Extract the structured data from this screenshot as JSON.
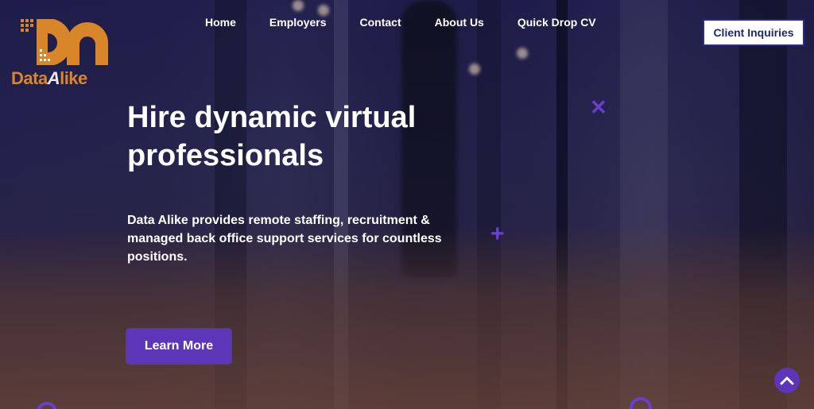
{
  "brand": {
    "name_part1": "Data",
    "name_part2": "A",
    "name_part3": "like",
    "primary_color": "#d9862b",
    "accent_color": "#5d35b8"
  },
  "nav": {
    "items": [
      {
        "label": "Home"
      },
      {
        "label": "Employers"
      },
      {
        "label": "Contact"
      },
      {
        "label": "About Us"
      },
      {
        "label": "Quick Drop CV"
      }
    ],
    "client_button": "Client Inquiries"
  },
  "hero": {
    "headline": "Hire dynamic virtual professionals",
    "subtext": "Data Alike provides remote staffing, recruitment & managed back office support services for countless positions.",
    "cta_label": "Learn More"
  },
  "icons": {
    "scroll_top": "chevron-up-icon"
  }
}
